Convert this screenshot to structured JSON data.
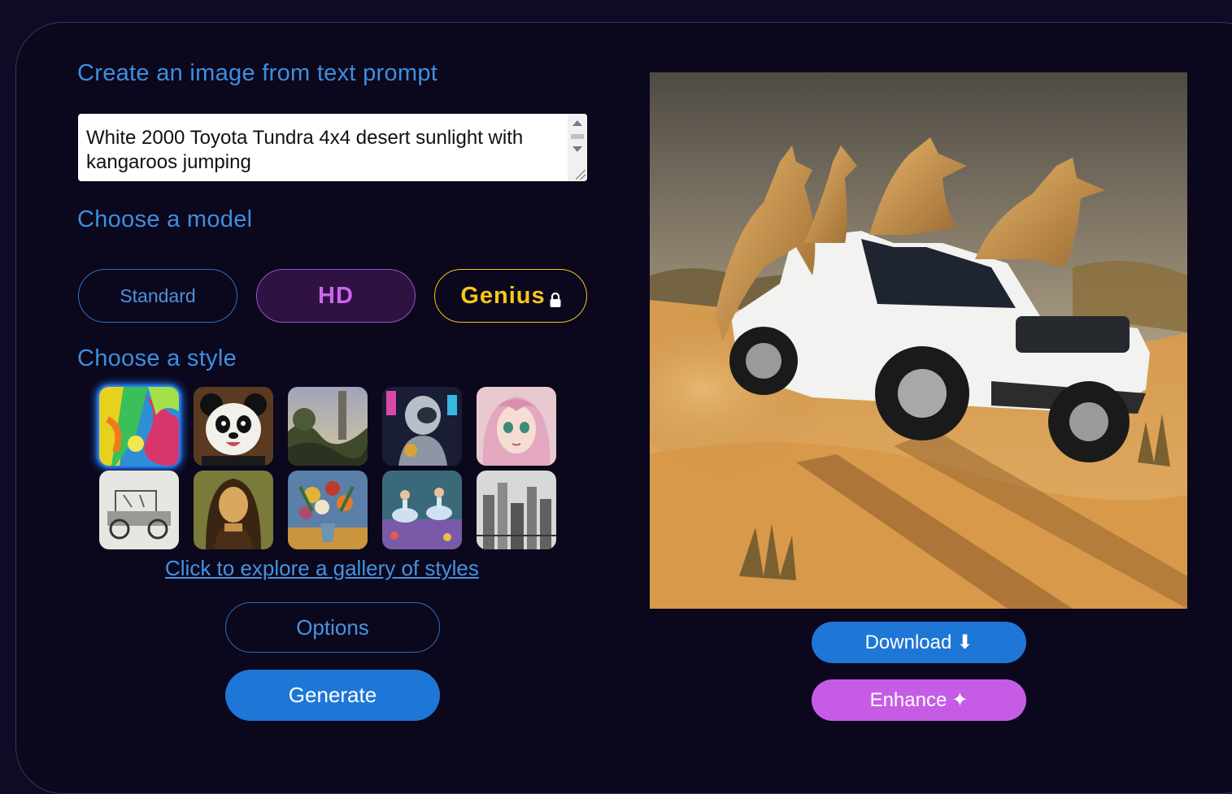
{
  "headings": {
    "create": "Create an image from text prompt",
    "model": "Choose a model",
    "style": "Choose a style"
  },
  "prompt": {
    "value": "White 2000 Toyota Tundra 4x4 desert sunlight with kangaroos jumping"
  },
  "models": {
    "standard": "Standard",
    "hd": "HD",
    "genius": "Genius",
    "genius_locked": true,
    "selected": "HD"
  },
  "styles": {
    "selected_index": 0,
    "items": [
      {
        "icon": "abstract-colorful-style"
      },
      {
        "icon": "panda-cartoon-style"
      },
      {
        "icon": "landscape-painting-style"
      },
      {
        "icon": "cyberpunk-robot-style"
      },
      {
        "icon": "anime-portrait-style"
      },
      {
        "icon": "pencil-sketch-car-style"
      },
      {
        "icon": "renaissance-portrait-style"
      },
      {
        "icon": "flower-still-life-style"
      },
      {
        "icon": "impressionist-dancers-style"
      },
      {
        "icon": "ink-city-drawing-style"
      }
    ],
    "gallery_link": "Click to explore a gallery of styles"
  },
  "actions": {
    "options": "Options",
    "generate": "Generate",
    "download": "Download",
    "download_icon": "⬇",
    "enhance": "Enhance",
    "enhance_icon": "✦"
  },
  "result": {
    "image_icon": "generated-truck-kangaroos-image"
  },
  "colors": {
    "background": "#110a27",
    "panel": "#0b071d",
    "heading": "#3d8fde",
    "primary": "#1e76d6",
    "hd": "#cf64ef",
    "genius": "#f6c81a",
    "enhance": "#c65ce6"
  }
}
